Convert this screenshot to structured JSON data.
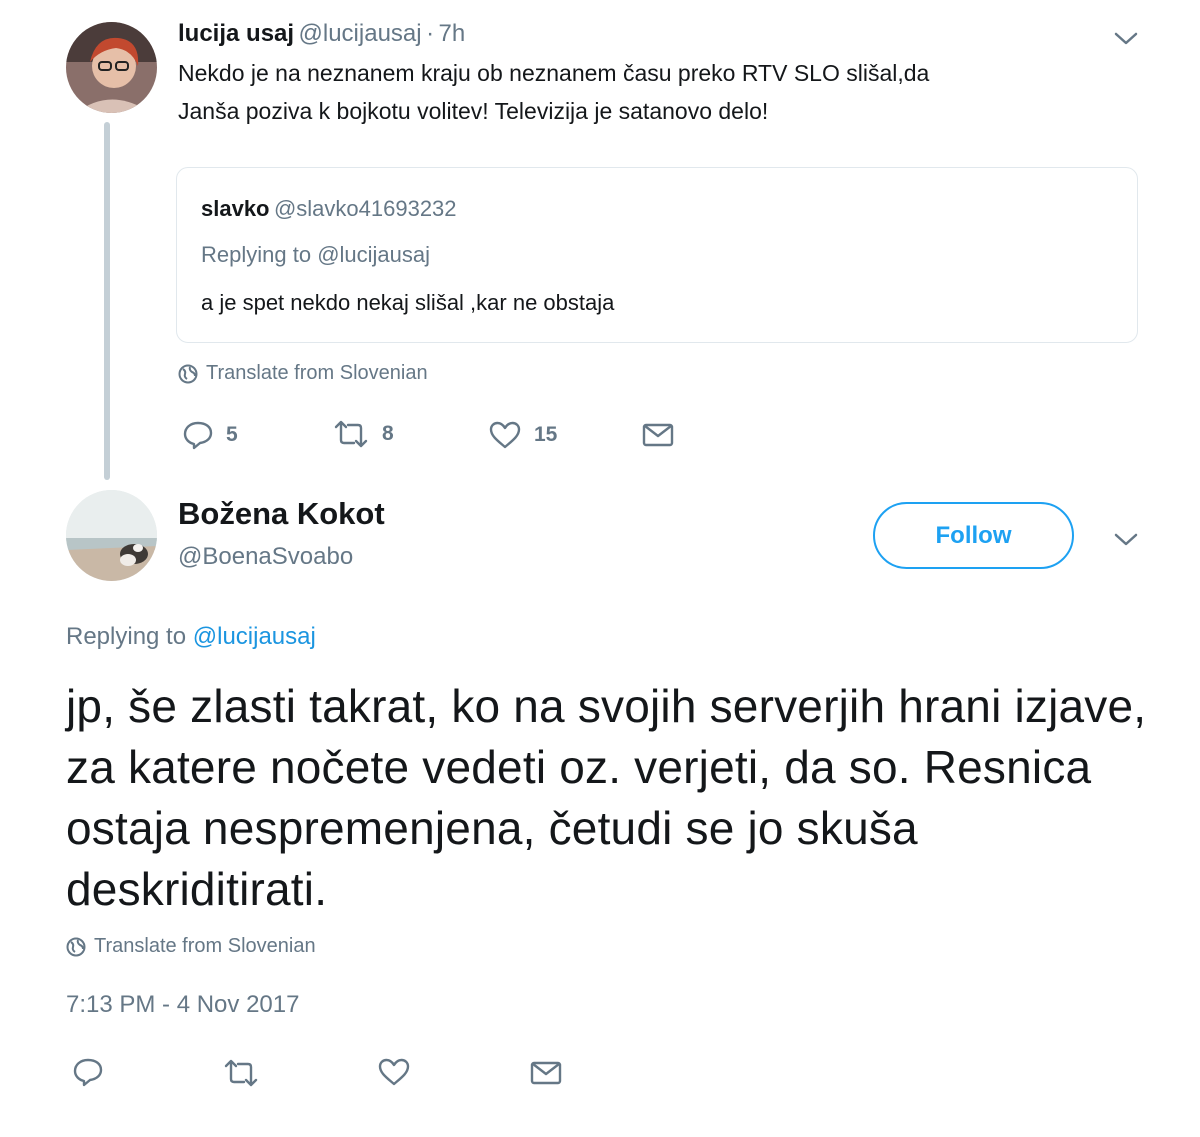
{
  "parent_tweet": {
    "name": "lucija usaj",
    "handle": "@lucijausaj",
    "separator": "·",
    "time": "7h",
    "text_line1": "Nekdo je na neznanem kraju ob neznanem času preko RTV SLO slišal,da",
    "text_line2": "Janša poziva k bojkotu volitev! Televizija je satanovo delo!",
    "quote": {
      "name": "slavko",
      "handle": "@slavko41693232",
      "replying_prefix": "Replying to",
      "replying_handle": "@lucijausaj",
      "text": "a je spet nekdo nekaj slišal ,kar ne obstaja"
    },
    "translate_label": "Translate from Slovenian",
    "counts": {
      "replies": "5",
      "retweets": "8",
      "likes": "15"
    }
  },
  "main_tweet": {
    "name": "Božena Kokot",
    "handle": "@BoenaSvoabo",
    "follow_label": "Follow",
    "replying_prefix": "Replying to",
    "replying_handle": "@lucijausaj",
    "text": "jp, še zlasti takrat, ko na svojih serverjih hrani izjave, za katere nočete vedeti oz. verjeti, da so. Resnica ostaja nespremenjena, četudi se jo skuša deskriditirati.",
    "translate_label": "Translate from Slovenian",
    "timestamp": "7:13 PM - 4 Nov 2017"
  },
  "colors": {
    "accent": "#1da1f2",
    "muted": "#657786",
    "text": "#14171a",
    "border": "#e1e8ed"
  },
  "icons": [
    "chevron-down-icon",
    "globe-icon",
    "reply-icon",
    "retweet-icon",
    "like-icon",
    "message-icon"
  ]
}
